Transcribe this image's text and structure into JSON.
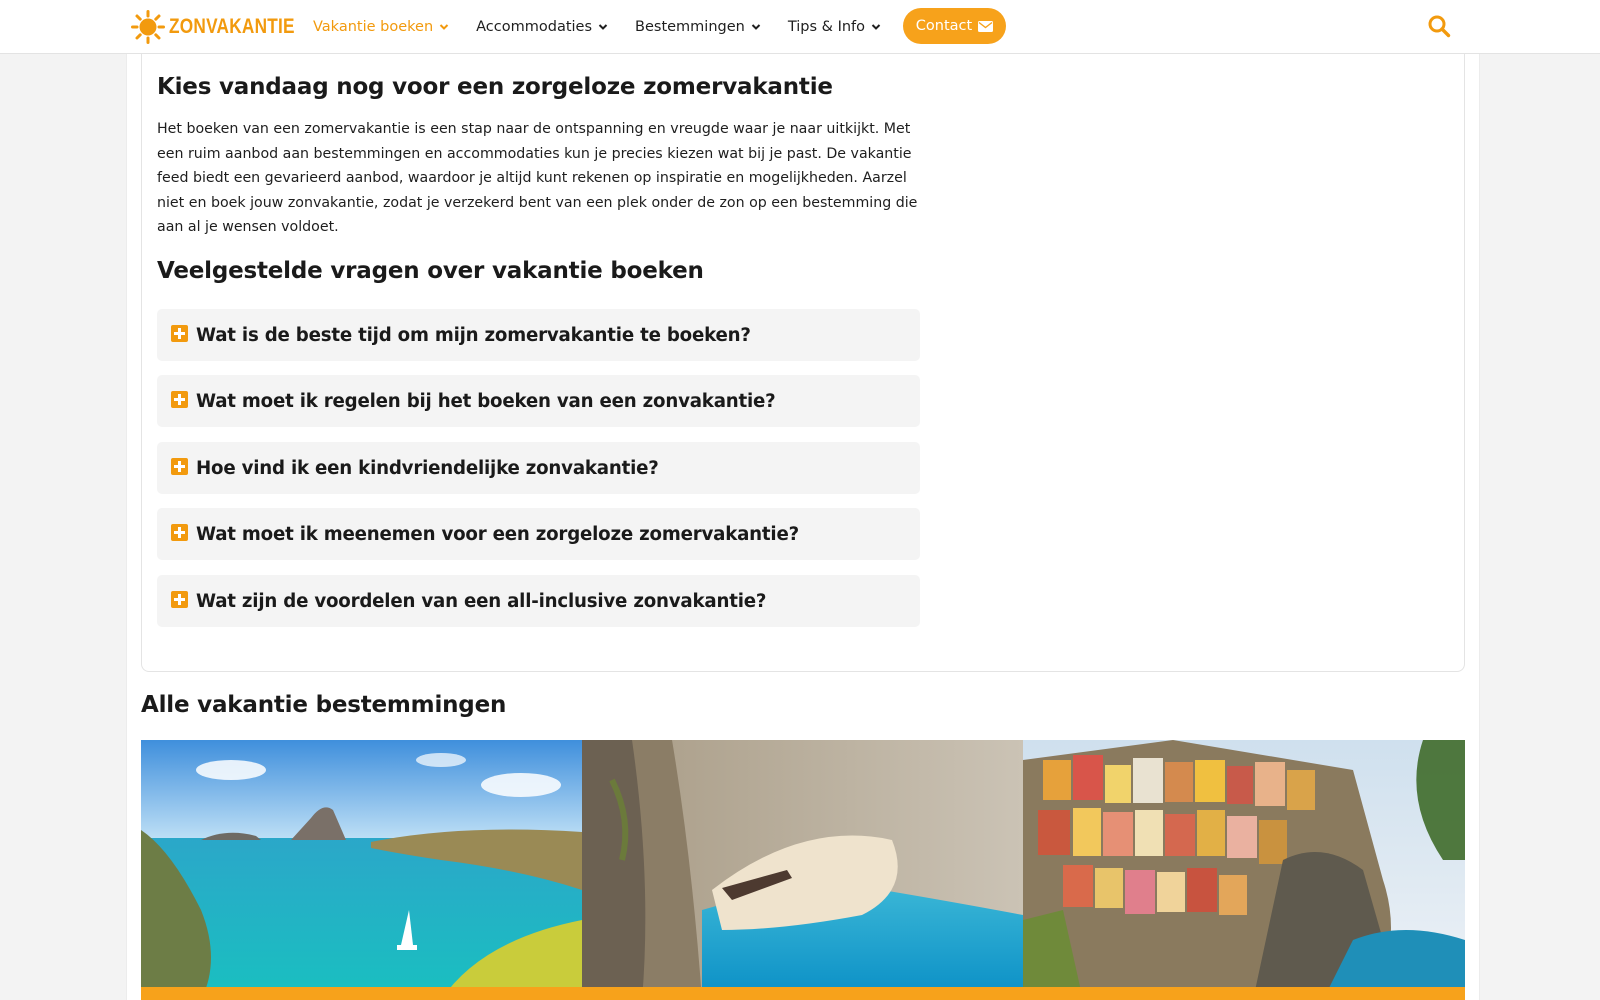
{
  "brand": {
    "name": "ZONVAKANTIE",
    "accent": "#f29a0e",
    "button": "#f7a21b"
  },
  "nav": {
    "items": [
      {
        "label": "Vakantie boeken",
        "active": true
      },
      {
        "label": "Accommodaties",
        "active": false
      },
      {
        "label": "Bestemmingen",
        "active": false
      },
      {
        "label": "Tips & Info",
        "active": false
      }
    ],
    "contact_label": "Contact"
  },
  "intro": {
    "title": "Kies vandaag nog voor een zorgeloze zomervakantie",
    "text": "Het boeken van een zomervakantie is een stap naar de ontspanning en vreugde waar je naar uitkijkt. Met een ruim aanbod aan bestemmingen en accommodaties kun je precies kiezen wat bij je past. De vakantie feed biedt een gevarieerd aanbod, waardoor je altijd kunt rekenen op inspiratie en mogelijkheden. Aarzel niet en boek jouw zonvakantie, zodat je verzekerd bent van een plek onder de zon op een bestemming die aan al je wensen voldoet."
  },
  "faq": {
    "title": "Veelgestelde vragen over vakantie boeken",
    "items": [
      "Wat is de beste tijd om mijn zomervakantie te boeken?",
      "Wat moet ik regelen bij het boeken van een zonvakantie?",
      "Hoe vind ik een kindvriendelijke zonvakantie?",
      "Wat moet ik meenemen voor een zorgeloze zomervakantie?",
      "Wat zijn de voordelen van een all-inclusive zonvakantie?"
    ]
  },
  "destinations": {
    "title": "Alle vakantie bestemmingen"
  }
}
